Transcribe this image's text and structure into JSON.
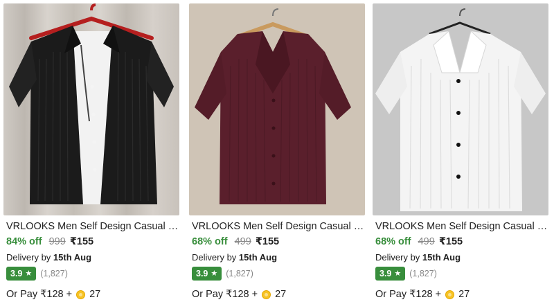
{
  "products": [
    {
      "title": "VRLOOKS Men Self Design Casual Bla...",
      "discount": "84% off",
      "mrp": "999",
      "price": "₹155",
      "delivery_prefix": "Delivery by",
      "delivery_date": "15th Aug",
      "rating": "3.9",
      "rating_count": "(1,827)",
      "pay_prefix": "Or Pay ₹128 +",
      "coins": "27",
      "shirt_color": "#1b1b1b"
    },
    {
      "title": "VRLOOKS Men Self Design Casual Ma...",
      "discount": "68% off",
      "mrp": "499",
      "price": "₹155",
      "delivery_prefix": "Delivery by",
      "delivery_date": "15th Aug",
      "rating": "3.9",
      "rating_count": "(1,827)",
      "pay_prefix": "Or Pay ₹128 +",
      "coins": "27",
      "shirt_color": "#5a1f2c"
    },
    {
      "title": "VRLOOKS Men Self Design Casual Whi...",
      "discount": "68% off",
      "mrp": "499",
      "price": "₹155",
      "delivery_prefix": "Delivery by",
      "delivery_date": "15th Aug",
      "rating": "3.9",
      "rating_count": "(1,827)",
      "pay_prefix": "Or Pay ₹128 +",
      "coins": "27",
      "shirt_color": "#f4f4f4"
    }
  ],
  "icons": {
    "rating": "star-icon",
    "coin": "supercoin-icon"
  },
  "colors": {
    "discount": "#388e3c",
    "badge": "#388e3c",
    "mrp": "#878787"
  }
}
